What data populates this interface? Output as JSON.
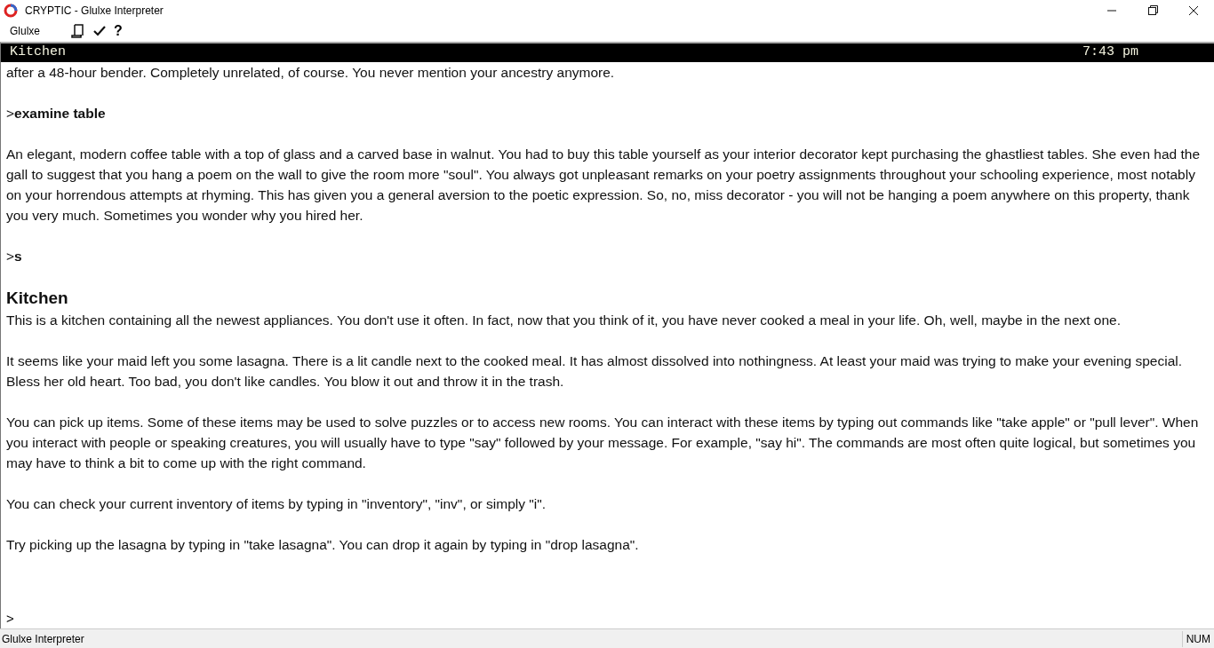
{
  "window": {
    "title": "CRYPTIC - Glulxe Interpreter"
  },
  "menu": {
    "label": "Glulxe"
  },
  "toolbar": [
    {
      "kind": "scroll"
    },
    {
      "kind": "check"
    },
    {
      "kind": "help",
      "label": "?"
    }
  ],
  "status_line": {
    "location": "Kitchen",
    "time": "7:43 pm"
  },
  "transcript": [
    {
      "kind": "text",
      "text": "after a 48-hour bender. Completely unrelated, of course. You never mention your ancestry anymore."
    },
    {
      "kind": "command",
      "prompt": ">",
      "text": "examine table"
    },
    {
      "kind": "text",
      "text": "An elegant, modern coffee table with a top of glass and a carved base in walnut. You had to buy this table yourself as your interior decorator kept purchasing the ghastliest tables. She even had the gall to suggest that you hang a poem on the wall to give the room more \"soul\". You always got unpleasant remarks on your poetry assignments throughout your schooling experience, most notably on your horrendous attempts at rhyming. This has given you a general aversion to the poetic expression. So, no, miss decorator - you will not be hanging a poem anywhere on this property, thank you very much. Sometimes you wonder why you hired her."
    },
    {
      "kind": "command",
      "prompt": ">",
      "text": "s"
    },
    {
      "kind": "heading",
      "text": "Kitchen"
    },
    {
      "kind": "text",
      "text": "This is a kitchen containing all the newest appliances. You don't use it often. In fact, now that you think of it, you have never cooked a meal in your life. Oh, well, maybe in the next one."
    },
    {
      "kind": "text",
      "text": "It seems like your maid left you some lasagna.  There is a lit candle next to the cooked meal. It has almost dissolved into nothingness. At least your maid was trying to make your evening special. Bless her old heart. Too bad, you don't like candles. You blow it out and throw it in the trash."
    },
    {
      "kind": "text",
      "text": "You can pick up items. Some of these items may be used to solve puzzles or to access new rooms. You can interact with these items by typing out commands like \"take apple\" or \"pull lever\". When you interact with people or speaking creatures, you will usually have to type \"say\" followed by your message. For example, \"say hi\". The commands are most often quite logical, but sometimes you may have to think a bit to come up with the right command."
    },
    {
      "kind": "text",
      "text": "You can check your current inventory of items by typing in \"inventory\", \"inv\", or simply \"i\"."
    },
    {
      "kind": "text",
      "text": "Try picking up the lasagna by typing in \"take lasagna\". You can drop it again by typing in \"drop lasagna\"."
    }
  ],
  "input_prompt": ">",
  "status_bar": {
    "text": "Glulxe Interpreter",
    "indicator": "NUM"
  }
}
